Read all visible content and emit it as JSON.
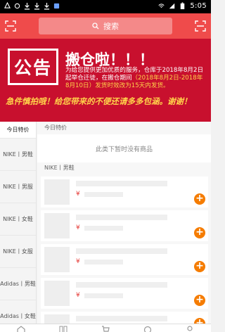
{
  "status_bar": {
    "time": "5:05",
    "icons": [
      "notification-icon",
      "phone-icon",
      "download-icon",
      "download-icon",
      "download-icon",
      "app-icon",
      "wifi-icon",
      "signal-icon",
      "battery-icon"
    ]
  },
  "header": {
    "search_placeholder": "搜索",
    "scan_icon": "scan-icon",
    "message_icon": "scan-icon"
  },
  "banner": {
    "badge": "公告",
    "title": "搬仓啦！！！",
    "body_white": "为给您提供更加优质的服务，仓库于2018年8月2日起举仓迁徒，在搬仓期间",
    "body_yellow": "（2018年8月2日-2018年8月10日）",
    "body_white2": "发货时效改为15天内发货。",
    "footer": "急件慎拍哦！给您带来的不便还请多多包涵。谢谢！"
  },
  "sidebar": {
    "items": [
      {
        "label": "今日特价",
        "active": true
      },
      {
        "label": "NIKE丨男鞋",
        "active": false
      },
      {
        "label": "NIKE丨男服",
        "active": false
      },
      {
        "label": "NIKE丨女鞋",
        "active": false
      },
      {
        "label": "NIKE丨女服",
        "active": false
      },
      {
        "label": "Adidas丨男鞋",
        "active": false
      },
      {
        "label": "Adidas丨女鞋",
        "active": false
      }
    ]
  },
  "main": {
    "section1_title": "今日特价",
    "empty_text": "此类下暂时没有商品",
    "section2_title": "NIKE丨男鞋",
    "products": [
      {
        "price": "¥",
        "add": "+"
      },
      {
        "price": "¥",
        "add": "+"
      },
      {
        "price": "¥",
        "add": "+"
      },
      {
        "price": "¥",
        "add": "+"
      },
      {
        "price": "¥",
        "add": "+"
      }
    ]
  },
  "colors": {
    "header": "#ef4b4b",
    "banner": "#c8102e",
    "accent_yellow": "#ffd24a",
    "add_button": "#f57c00",
    "price": "#e53935"
  }
}
